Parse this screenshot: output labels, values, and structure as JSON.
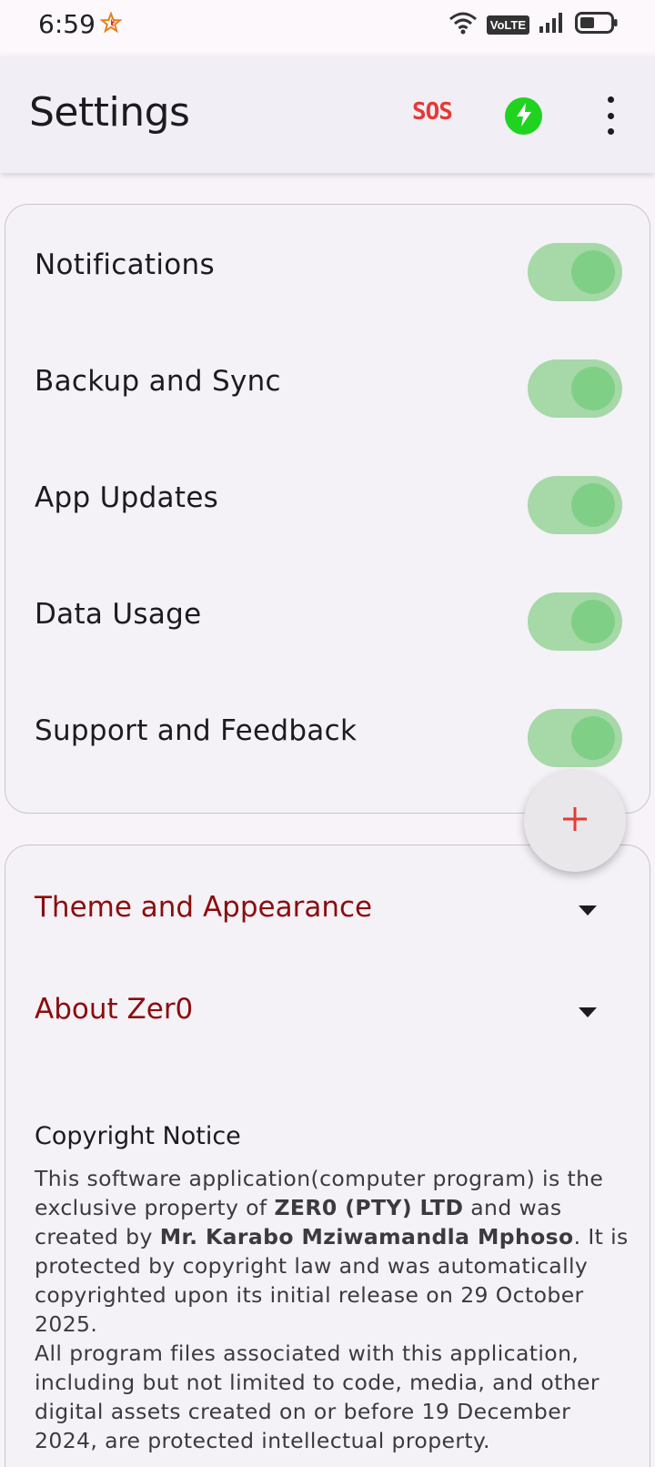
{
  "status_bar": {
    "time": "6:59",
    "network_label": "VoLTE"
  },
  "app_bar": {
    "title": "Settings",
    "sos_label": "SOS",
    "accent_power": "#21d321",
    "sos_color": "#e53935"
  },
  "toggles": [
    {
      "label": "Notifications",
      "enabled": true
    },
    {
      "label": "Backup and Sync",
      "enabled": true
    },
    {
      "label": "App Updates",
      "enabled": true
    },
    {
      "label": "Data Usage",
      "enabled": true
    },
    {
      "label": "Support and Feedback",
      "enabled": true
    }
  ],
  "sections": [
    {
      "label": "Theme and Appearance",
      "expanded": false
    },
    {
      "label": "About Zer0",
      "expanded": false
    }
  ],
  "copyright": {
    "title": "Copyright Notice",
    "p1_a": "This software application(computer program) is the exclusive property of ",
    "company": "ZER0 (PTY) LTD",
    "p1_b": " and was created by ",
    "author": "Mr. Karabo Mziwamandla Mphoso",
    "p1_c": ". It is protected by copyright law and was automatically copyrighted upon its initial release on 29 October 2025.",
    "p2": "All program files associated with this application, including but not limited to code, media, and other digital assets created on or before 19 December 2024, are protected intellectual property."
  },
  "fab": {
    "icon": "plus-icon",
    "color": "#e53935"
  }
}
